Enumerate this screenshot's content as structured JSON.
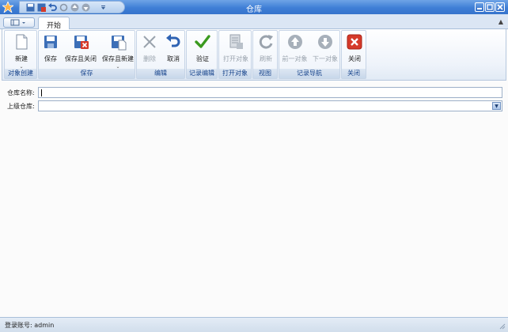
{
  "window": {
    "title": "仓库"
  },
  "tabs": {
    "home": "开始"
  },
  "ribbon": {
    "groups": {
      "create": "对象创建",
      "save": "保存",
      "edit": "编辑",
      "record_edit": "记录编辑",
      "open_object": "打开对象",
      "view": "视图",
      "record_nav": "记录导航",
      "close": "关闭"
    },
    "buttons": {
      "new": "新建",
      "save": "保存",
      "save_close": "保存且关闭",
      "save_new": "保存且新建",
      "delete": "删除",
      "cancel": "取消",
      "validate": "验证",
      "open_object": "打开对象",
      "refresh": "刷新",
      "prev": "前一对象",
      "next": "下一对象",
      "close": "关闭"
    }
  },
  "form": {
    "name_label": "仓库名称:",
    "name_value": "",
    "parent_label": "上级仓库:",
    "parent_value": ""
  },
  "status": {
    "login": "登录账号: admin"
  },
  "colors": {
    "titlebar": "#3f7fd6",
    "accent": "#15428b",
    "validate_green": "#3a9a1f",
    "close_red": "#d53a2a"
  }
}
